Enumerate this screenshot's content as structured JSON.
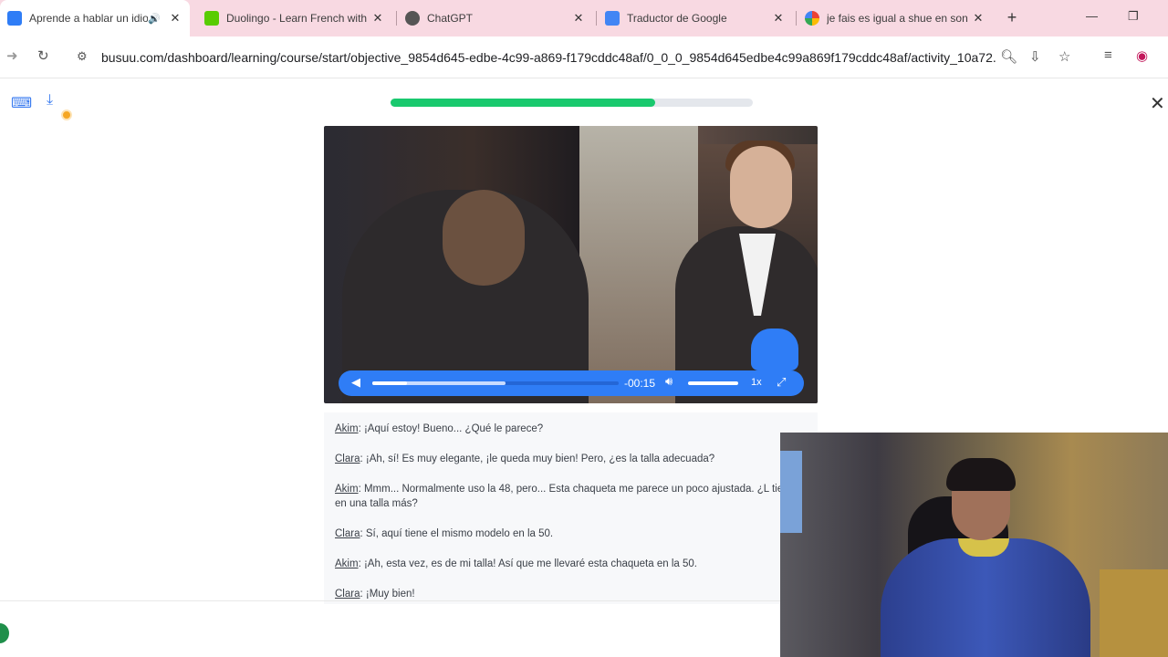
{
  "browser": {
    "tabs": [
      {
        "title": "Aprende a hablar un idio",
        "active": true,
        "icon": "busuu-icon",
        "icon_color": "#2f7df6",
        "audio": true
      },
      {
        "title": "Duolingo - Learn French with",
        "active": false,
        "icon": "duolingo-icon",
        "icon_color": "#58cc02"
      },
      {
        "title": "ChatGPT",
        "active": false,
        "icon": "chatgpt-icon",
        "icon_color": "#555555"
      },
      {
        "title": "Traductor de Google",
        "active": false,
        "icon": "google-translate-icon",
        "icon_color": "#4285f4"
      },
      {
        "title": "je fais es igual a shue en son",
        "active": false,
        "icon": "google-icon",
        "icon_color": "#4285f4"
      }
    ],
    "tab_close": "✕",
    "new_tab": "+",
    "minimize": "—",
    "restore": "❐",
    "url": "busuu.com/dashboard/learning/course/start/objective_9854d645-edbe-4c99-a869-f179cddc48af/0_0_0_9854d645edbe4c99a869f179cddc48af/activity_10a72..."
  },
  "lesson": {
    "progress": 0.73,
    "progress_color": "#19c96e",
    "close_label": "✕"
  },
  "player": {
    "time_remaining": "-00:15",
    "played": 0.14,
    "buffered": 0.54,
    "volume": 1.0,
    "speed": "1x",
    "accent": "#2f7df6"
  },
  "transcript": [
    {
      "speaker": "Akim",
      "text": ": ¡Aquí estoy! Bueno... ¿Qué le parece?"
    },
    {
      "speaker": "Clara",
      "text": ": ¡Ah, sí! Es muy elegante, ¡le queda muy bien! Pero, ¿es la talla adecuada?"
    },
    {
      "speaker": "Akim",
      "text": ": Mmm... Normalmente uso la 48, pero... Esta chaqueta me parece un poco ajustada. ¿L tiene en una talla más?"
    },
    {
      "speaker": "Clara",
      "text": ": Sí, aquí tiene el mismo modelo en la 50."
    },
    {
      "speaker": "Akim",
      "text": ": ¡Ah, esta vez, es de mi talla! Así que me llevaré esta chaqueta en la 50."
    },
    {
      "speaker": "Clara",
      "text": ": ¡Muy bien!"
    }
  ]
}
